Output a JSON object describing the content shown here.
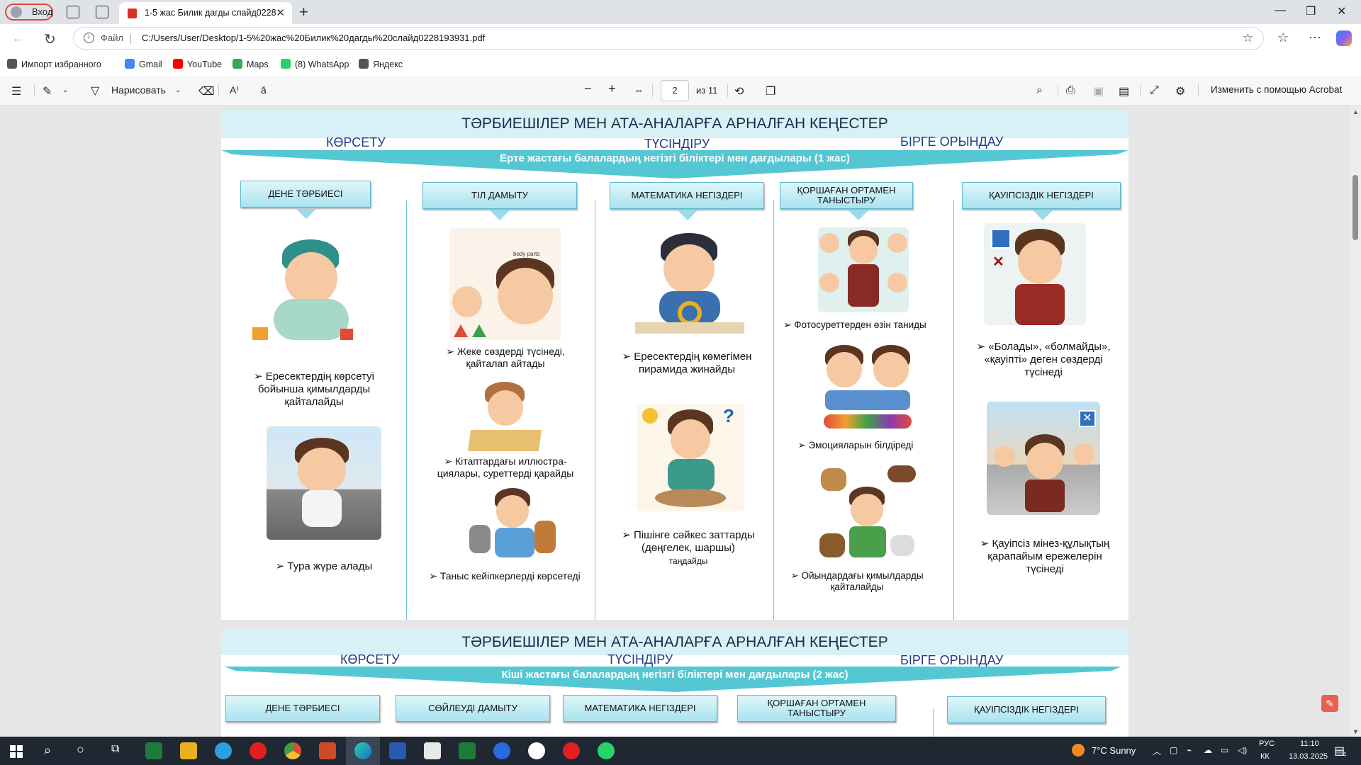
{
  "browser": {
    "profile_label": "Вход",
    "tab_title": "1-5 жас Билик дагды слайд0228",
    "url_label": "Файл",
    "url": "C:/Users/User/Desktop/1-5%20жас%20Билик%20дагды%20слайд0228193931.pdf",
    "bookmarks": [
      {
        "label": "Импорт избранного",
        "icon": "import-icon",
        "color": "#555555"
      },
      {
        "label": "Gmail",
        "icon": "google-icon",
        "color": "#4285f4"
      },
      {
        "label": "YouTube",
        "icon": "youtube-icon",
        "color": "#ff0000"
      },
      {
        "label": "Maps",
        "icon": "maps-icon",
        "color": "#34a853"
      },
      {
        "label": "(8) WhatsApp",
        "icon": "whatsapp-icon",
        "color": "#25d366"
      },
      {
        "label": "Яндекс",
        "icon": "globe-icon",
        "color": "#555555"
      }
    ]
  },
  "pdf_toolbar": {
    "draw_label": "Нарисовать",
    "page_current": "2",
    "page_total": "из 11",
    "acrobat_label": "Изменить с помощью Acrobat"
  },
  "page1": {
    "title": "ТӘРБИЕШІЛЕР МЕН АТА-АНАЛАРҒА АРНАЛҒАН КЕҢЕСТЕР",
    "sub_left": "КӨРСЕТУ",
    "sub_mid": "ТҮСІНДІРУ",
    "sub_right": "БІРГЕ ОРЫНДАУ",
    "banner": "Ерте жастағы балалардың негізгі біліктері мен дағдылары (1 жас)",
    "columns": [
      {
        "header": "ДЕНЕ ТӘРБИЕСІ",
        "items": [
          "➢ Ересектердің көрсетуі бойынша қимылдарды қайталайды",
          "➢ Тура жүре алады"
        ]
      },
      {
        "header": "ТІЛ ДАМЫТУ",
        "items": [
          "➢ Жеке сөздерді түсінеді, қайталап айтады",
          "➢ Кітаптардағы иллюстра-циялары, суреттерді қарайды",
          "➢ Таныс кейіпкерлерді көрсетеді"
        ],
        "image_text": "body parts"
      },
      {
        "header": "МАТЕМАТИКА НЕГІЗДЕРІ",
        "items": [
          "➢ Ересектердің көмегімен пирамида жинайды",
          "➢ Пішінге сәйкес заттарды (дөңгелек, шаршы)",
          "таңдайды"
        ]
      },
      {
        "header": "ҚОРШАҒАН ОРТАМЕН ТАНЫСТЫРУ",
        "items": [
          "➢ Фотосуреттерден өзін таниды",
          "➢ Эмоцияларын білдіреді",
          "➢ Ойындардағы қимылдарды қайталайды"
        ]
      },
      {
        "header": "ҚАУІПСІЗДІК НЕГІЗДЕРІ",
        "items": [
          "➢ «Болады», «болмайды», «қауіпті» деген сөздерді түсінеді",
          "➢ Қауіпсіз мінез-құлықтың қарапайым ережелерін түсінеді"
        ]
      }
    ]
  },
  "page2": {
    "title": "ТӘРБИЕШІЛЕР МЕН АТА-АНАЛАРҒА АРНАЛҒАН КЕҢЕСТЕР",
    "sub_left": "КӨРСЕТУ",
    "sub_mid": "ТҮСІНДІРУ",
    "sub_right": "БІРГЕ ОРЫНДАУ",
    "banner": "Кіші жастағы балалардың негізгі біліктері мен дағдылары (2 жас)",
    "headers": [
      "ДЕНЕ ТӘРБИЕСІ",
      "СӨЙЛЕУДІ ДАМЫТУ",
      "МАТЕМАТИКА НЕГІЗДЕРІ",
      "ҚОРШАҒАН ОРТАМЕН ТАНЫСТЫРУ",
      "ҚАУІПСІЗДІК НЕГІЗДЕРІ"
    ]
  },
  "taskbar": {
    "weather": "7°C  Sunny",
    "lang_1": "РУС",
    "lang_2": "КК",
    "time": "11:10",
    "date": "13.03.2025",
    "notifications": "4"
  }
}
